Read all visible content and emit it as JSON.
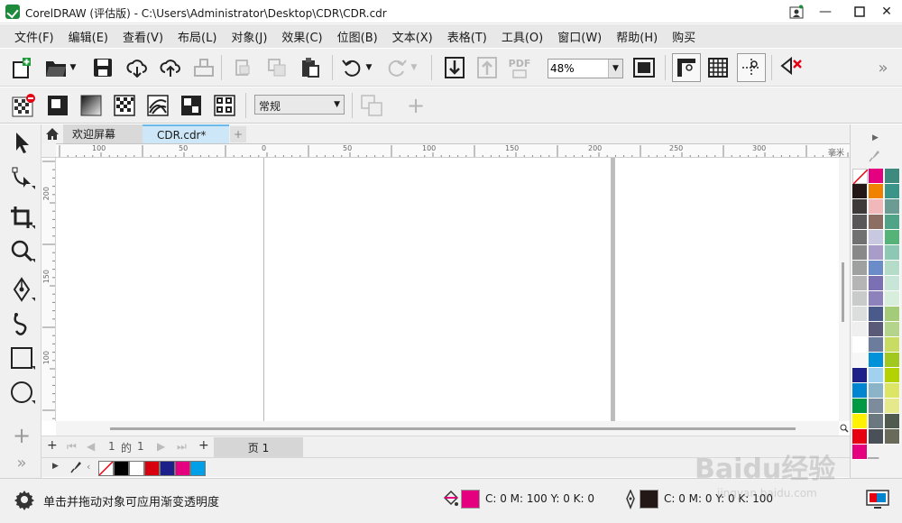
{
  "window": {
    "title": "CorelDRAW (评估版) - C:\\Users\\Administrator\\Desktop\\CDR\\CDR.cdr",
    "app_icon": "coreldraw-logo-icon"
  },
  "menu": [
    "文件(F)",
    "编辑(E)",
    "查看(V)",
    "布局(L)",
    "对象(J)",
    "效果(C)",
    "位图(B)",
    "文本(X)",
    "表格(T)",
    "工具(O)",
    "窗口(W)",
    "帮助(H)",
    "购买"
  ],
  "toolbar": {
    "zoom_value": "48%",
    "pdf_label": "PDF"
  },
  "property_bar": {
    "style_value": "常规"
  },
  "tabs": {
    "welcome": "欢迎屏幕",
    "document": "CDR.cdr*"
  },
  "rulers": {
    "horizontal": [
      "100",
      "50",
      "0",
      "50",
      "100",
      "150",
      "200",
      "250",
      "300"
    ],
    "vertical": [
      "200",
      "150",
      "100"
    ],
    "unit": "毫米"
  },
  "page_nav": {
    "current": "1",
    "of": "的",
    "total": "1",
    "page_tab": "页 1"
  },
  "document_palette": [
    "#000000",
    "#ffffff",
    "#d7000f",
    "#1d2088",
    "#e4007f",
    "#00a0e9"
  ],
  "color_palette": [
    "#231815",
    "#e4007f",
    "#3e8a7e",
    "#3e3a39",
    "#f08200",
    "#3a9488",
    "#595757",
    "#f0b8b8",
    "#6a9c94",
    "#727171",
    "#8c6e62",
    "#4fa387",
    "#898989",
    "#c8c8e0",
    "#55b378",
    "#9fa0a0",
    "#a89cc8",
    "#8cc8b4",
    "#b5b5b6",
    "#6a8cc8",
    "#b4dcc8",
    "#c9caca",
    "#7b70b3",
    "#c8e6d8",
    "#dcdddd",
    "#8e82bc",
    "#d8eedc",
    "#efefef",
    "#4a5a8a",
    "#a4cc78",
    "#ffffff",
    "#5a5a78",
    "#b4d48c",
    "#f7f7f7",
    "#6c7c9c",
    "#c8dc64",
    "#1d2088",
    "#0092d8",
    "#a0c81e",
    "#0086d1",
    "#a0d2f0",
    "#b4d200",
    "#009944",
    "#8cb4c8",
    "#dce664",
    "#fff100",
    "#7c8c9c",
    "#e6e88c",
    "#e60012",
    "#6c7880",
    "#505a4e",
    "#e4007f",
    "#4a5058",
    "#6a6a5a"
  ],
  "status": {
    "hint": "单击并拖动对象可应用渐变透明度",
    "fill_label": "C: 0 M: 100 Y: 0 K: 0",
    "outline_label": "C: 0 M: 0 Y: 0 K: 100",
    "fill_color": "#e4007f",
    "outline_color": "#231815"
  },
  "watermark": {
    "text": "Baidu经验",
    "sub": "jingyan.baidu.com"
  }
}
